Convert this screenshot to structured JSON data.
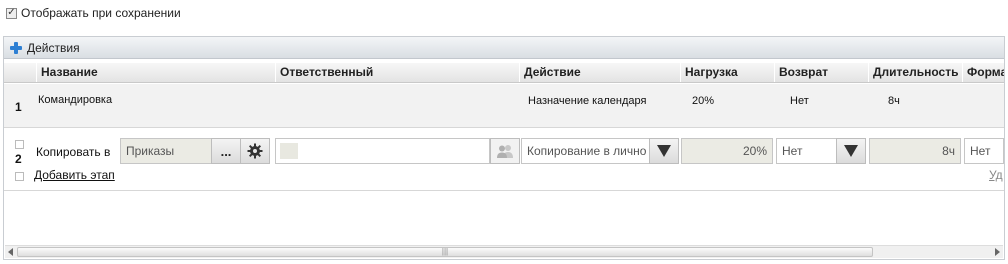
{
  "top_checkbox": {
    "label": "Отображать при сохранении",
    "checked": true
  },
  "toolbar": {
    "actions_label": "Действия",
    "icon": "plus-icon"
  },
  "columns": [
    "Название",
    "Ответственный",
    "Действие",
    "Нагрузка",
    "Возврат",
    "Длительность",
    "Форма"
  ],
  "rows": [
    {
      "number": "1",
      "name": "Командировка",
      "action": "Назначение календаря",
      "load": "20%",
      "return": "Нет",
      "duration": "8ч"
    }
  ],
  "edit_row": {
    "number": "2",
    "copy_label": "Копировать в",
    "copy_target": "Приказы",
    "ellipsis": "...",
    "responsible_value": "",
    "action_value": "Копирование в лично",
    "load_value": "20%",
    "return_value": "Нет",
    "duration_value": "8ч",
    "form_value": "Нет",
    "add_stage_label": "Добавить этап",
    "delete_label": "Уд"
  },
  "colors": {
    "accent": "#2d7fd3",
    "toolbar_bg": "#e3e7eb",
    "row_bg": "#f2f2f2"
  }
}
